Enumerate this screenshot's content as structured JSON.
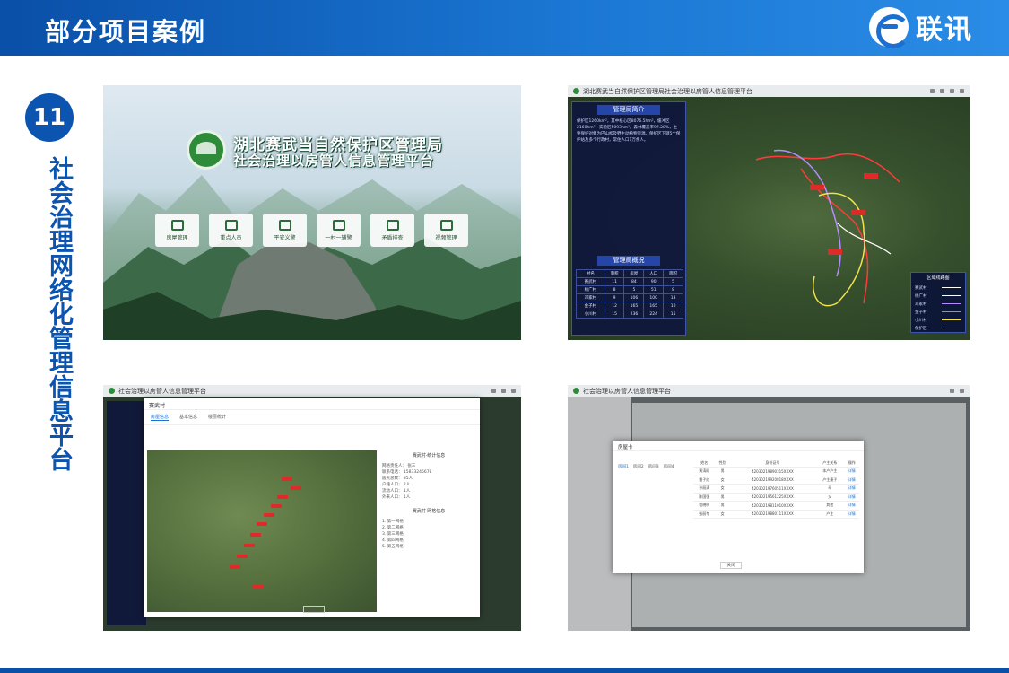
{
  "header": {
    "title": "部分项目案例"
  },
  "logo": {
    "text": "联讯",
    "icon": "e-globe-logo-icon"
  },
  "badge": {
    "number": "11"
  },
  "side_title": "社会治理网络化管理信息平台",
  "colors": {
    "brand_blue": "#0b54b0",
    "header_gradient_end": "#2a8ce6"
  },
  "screen1": {
    "title_line1": "湖北赛武当自然保护区管理局",
    "title_line2": "社会治理以房管人信息管理平台",
    "menu": [
      {
        "label": "房屋管理",
        "icon": "house-icon"
      },
      {
        "label": "重点人员",
        "icon": "users-icon"
      },
      {
        "label": "平安义警",
        "icon": "person-icon"
      },
      {
        "label": "一村一辅警",
        "icon": "person-check-icon"
      },
      {
        "label": "矛盾排查",
        "icon": "document-icon"
      },
      {
        "label": "视频管理",
        "icon": "camera-icon"
      }
    ]
  },
  "screen2": {
    "window_title": "湖北赛武当自然保护区管理局社会治理以房管人信息管理平台",
    "panel_heading": "管理局简介",
    "intro_text": "保护区1260km²，其中核心区8076.5hm²，缓冲区2160hm²，实验区5093hm²。森林覆盖率97.28%，主要保护对象为巴山松及野生动植物资源。保护区下辖5个保护站及多个行政村，常住人口1万余人。",
    "table_heading": "管理局概况",
    "table_headers": [
      "村名",
      "面积",
      "房屋",
      "人口",
      "面积"
    ],
    "table_rows": [
      [
        "赛武村",
        "11",
        "84",
        "90",
        "5"
      ],
      [
        "杨广村",
        "8",
        "5",
        "51",
        "8"
      ],
      [
        "邓家村",
        "9",
        "106",
        "100",
        "13"
      ],
      [
        "金子村",
        "12",
        "165",
        "165",
        "10"
      ],
      [
        "小川村",
        "15",
        "236",
        "224",
        "15"
      ]
    ],
    "legend_title": "区域线路图",
    "legend": [
      {
        "name": "赛武村",
        "color": "#ffffff"
      },
      {
        "name": "杨广村",
        "color": "#ffffff"
      },
      {
        "name": "邓家村",
        "color": "#b48cff"
      },
      {
        "name": "金子村",
        "color": "#ff7043"
      },
      {
        "name": "小川村",
        "color": "#f3e24a"
      },
      {
        "name": "保护区",
        "color": "#f3e24a"
      }
    ]
  },
  "screen3": {
    "window_title": "社会治理以房管人信息管理平台",
    "modal_title": "赛武村",
    "tabs": [
      "房屋信息",
      "基本信息",
      "楼层统计"
    ],
    "info_heading": "赛武村·统计信息",
    "info_rows": [
      "网格责任人：  张三",
      "联系电话：  15833245678",
      "居民总数：  35人",
      "户籍人口：  2人",
      "流动人口：  1人",
      "外来人口：  1人"
    ],
    "list_heading": "赛武村·网格信息",
    "list_items": [
      "1. 第一网格",
      "2. 第二网格",
      "3. 第三网格",
      "4. 第四网格",
      "5. 第五网格"
    ],
    "close_label": "关闭"
  },
  "screen4": {
    "window_title": "社会治理以房管人信息管理平台",
    "modal_title": "房屋卡",
    "tabs": [
      "房间1",
      "房间2",
      "房间3",
      "房间4"
    ],
    "headers": [
      "姓名",
      "性别",
      "身份证号",
      "户主关系",
      "操作"
    ],
    "rows": [
      [
        "黄涛刚",
        "男",
        "42030219890315XXXX",
        "本户户主",
        "详情"
      ],
      [
        "雷子红",
        "女",
        "42030219920818XXXX",
        "户主妻子",
        "详情"
      ],
      [
        "孙丽清",
        "女",
        "42030219760511XXXX",
        "母",
        "详情"
      ],
      [
        "陈国强",
        "男",
        "42030219561225XXXX",
        "父",
        "详情"
      ],
      [
        "程晓明",
        "男",
        "42030219811010XXXX",
        "其他",
        "详情"
      ],
      [
        "张丽冬",
        "女",
        "42030219880111XXXX",
        "户主",
        "详情"
      ]
    ],
    "close_label": "关闭"
  }
}
